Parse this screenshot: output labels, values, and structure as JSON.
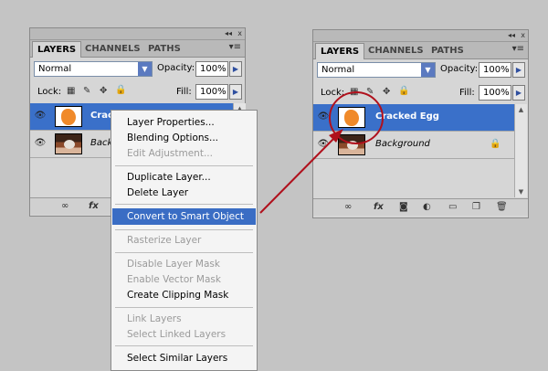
{
  "left_panel": {
    "collapse_glyph": "◂◂",
    "close_glyph": "x",
    "tabs": [
      "LAYERS",
      "CHANNELS",
      "PATHS"
    ],
    "menu_glyph": "▾≡",
    "blend_mode": "Normal",
    "opacity_label": "Opacity:",
    "opacity_value": "100%",
    "lock_label": "Lock:",
    "fill_label": "Fill:",
    "fill_value": "100%",
    "layers": [
      {
        "name": "Cracl",
        "selected": true
      },
      {
        "name": "Back",
        "selected": false
      }
    ]
  },
  "right_panel": {
    "collapse_glyph": "◂◂",
    "close_glyph": "x",
    "tabs": [
      "LAYERS",
      "CHANNELS",
      "PATHS"
    ],
    "menu_glyph": "▾≡",
    "blend_mode": "Normal",
    "opacity_label": "Opacity:",
    "opacity_value": "100%",
    "lock_label": "Lock:",
    "fill_label": "Fill:",
    "fill_value": "100%",
    "layers": [
      {
        "name": "Cracked Egg",
        "selected": true
      },
      {
        "name": "Background",
        "selected": false
      }
    ]
  },
  "context_menu": {
    "items": [
      {
        "label": "Layer Properties...",
        "disabled": false
      },
      {
        "label": "Blending Options...",
        "disabled": false
      },
      {
        "label": "Edit Adjustment...",
        "disabled": true
      },
      {
        "label": "Duplicate Layer...",
        "disabled": false
      },
      {
        "label": "Delete Layer",
        "disabled": false
      },
      {
        "label": "Convert to Smart Object",
        "disabled": false,
        "highlighted": true
      },
      {
        "label": "Rasterize Layer",
        "disabled": true
      },
      {
        "label": "Disable Layer Mask",
        "disabled": true
      },
      {
        "label": "Enable Vector Mask",
        "disabled": true
      },
      {
        "label": "Create Clipping Mask",
        "disabled": false
      },
      {
        "label": "Link Layers",
        "disabled": true
      },
      {
        "label": "Select Linked Layers",
        "disabled": true
      },
      {
        "label": "Select Similar Layers",
        "disabled": false
      }
    ]
  },
  "icons": {
    "eye": "👁",
    "link": "∞",
    "fx": "fx",
    "mask": "◙",
    "adjustment": "◐",
    "group": "▭",
    "new_layer": "❐",
    "trash": "🗑",
    "lock": "🔒",
    "chevron_down": "▼",
    "arrow_right": "▶",
    "scroll_up": "▲",
    "scroll_down": "▼",
    "lock_transparent": "▦",
    "lock_brush": "✎",
    "lock_move": "✥"
  },
  "colors": {
    "selection": "#3a70c9",
    "annotation": "#b0101c"
  }
}
